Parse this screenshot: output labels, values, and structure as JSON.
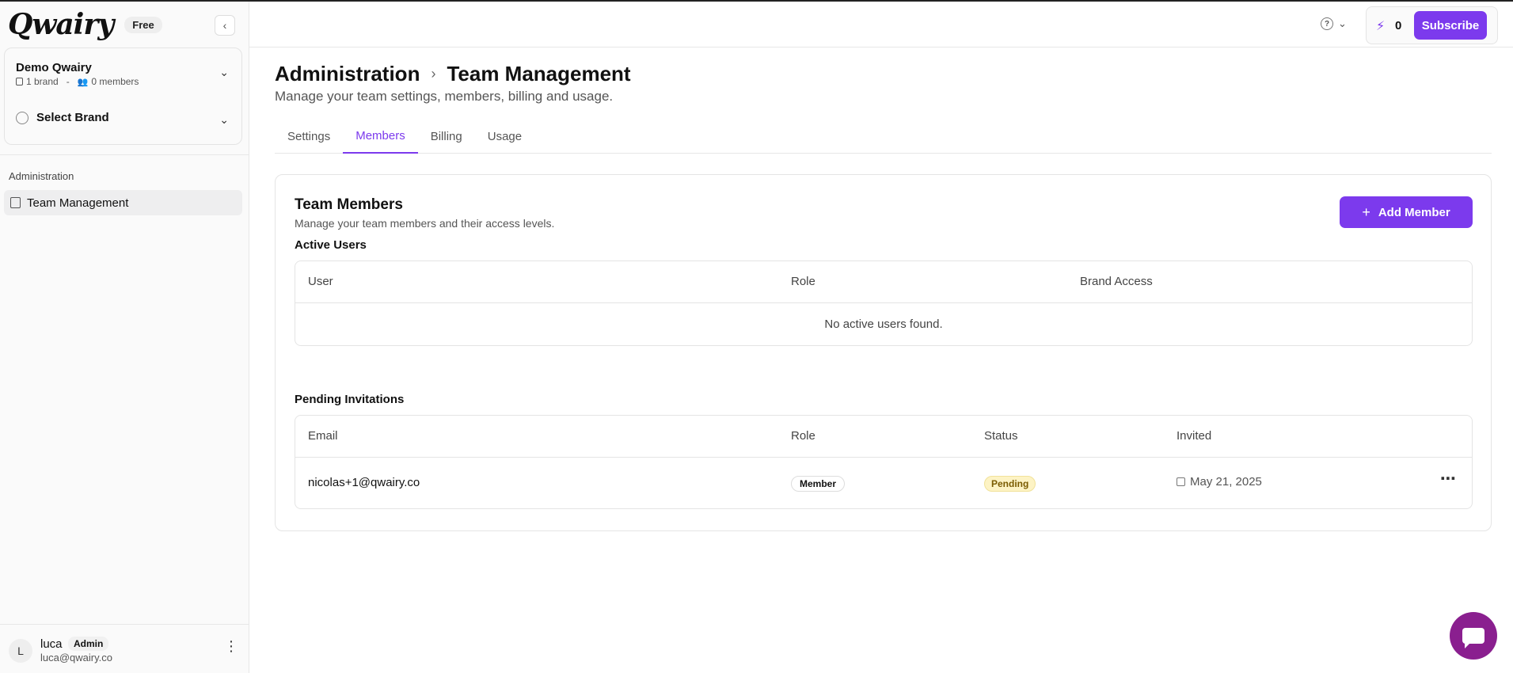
{
  "app": {
    "logo_text": "Qwairy",
    "plan_badge": "Free"
  },
  "org": {
    "name": "Demo Qwairy",
    "brand_count": "1 brand",
    "separator": "-",
    "member_count": "0 members"
  },
  "brand_selector": {
    "label": "Select Brand"
  },
  "sidebar": {
    "section_label": "Administration",
    "items": [
      {
        "label": "Team Management"
      }
    ]
  },
  "user": {
    "initial": "L",
    "name": "luca",
    "role_badge": "Admin",
    "email": "luca@qwairy.co"
  },
  "header": {
    "credits": "0",
    "subscribe_label": "Subscribe",
    "help_glyph": "?"
  },
  "page": {
    "breadcrumb_parent": "Administration",
    "breadcrumb_current": "Team Management",
    "subtitle": "Manage your team settings, members, billing and usage.",
    "tabs": [
      {
        "label": "Settings",
        "active": false
      },
      {
        "label": "Members",
        "active": true
      },
      {
        "label": "Billing",
        "active": false
      },
      {
        "label": "Usage",
        "active": false
      }
    ]
  },
  "team_card": {
    "title": "Team Members",
    "description": "Manage your team members and their access levels.",
    "add_button_label": "Add Member",
    "active_users": {
      "heading": "Active Users",
      "columns": [
        "User",
        "Role",
        "Brand Access"
      ],
      "empty_text": "No active users found."
    },
    "pending": {
      "heading": "Pending Invitations",
      "columns": [
        "Email",
        "Role",
        "Status",
        "Invited"
      ],
      "rows": [
        {
          "email": "nicolas+1@qwairy.co",
          "role": "Member",
          "status": "Pending",
          "invited": "May 21, 2025"
        }
      ]
    }
  },
  "colors": {
    "accent": "#7c3aed",
    "chat_button": "#8a1f8f",
    "pending_badge_bg": "#fdf3c4"
  }
}
